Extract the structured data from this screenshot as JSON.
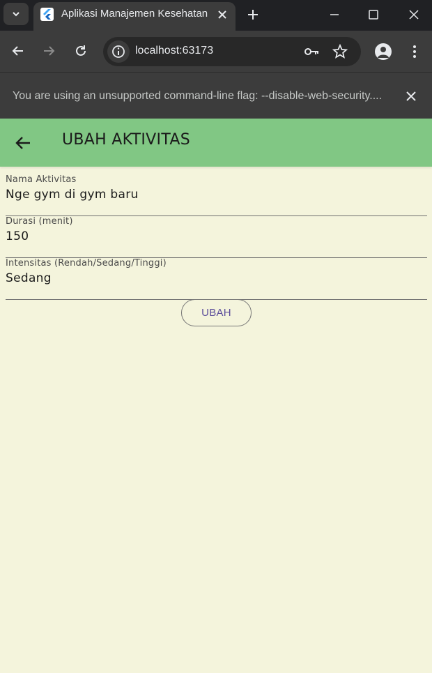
{
  "browser": {
    "tab_title": "Aplikasi Manajemen Kesehatan",
    "url": "localhost:63173",
    "infobar_message": "You are using an unsupported command-line flag: --disable-web-security...."
  },
  "appbar": {
    "title": "UBAH AKTIVITAS"
  },
  "form": {
    "fields": [
      {
        "label": "Nama Aktivitas",
        "value": "Nge gym di gym baru"
      },
      {
        "label": "Durasi (menit)",
        "value": "150"
      },
      {
        "label": "Intensitas (Rendah/Sedang/Tinggi)",
        "value": "Sedang"
      }
    ],
    "submit_label": "UBAH"
  },
  "colors": {
    "appbar_bg": "#81c784",
    "page_bg": "#f4f4dc",
    "button_text": "#5b4c9a",
    "browser_chrome": "#3c3c3c"
  },
  "icons": [
    "tab-search-icon",
    "flutter-favicon-icon",
    "close-icon",
    "plus-icon",
    "minimize-icon",
    "maximize-icon",
    "back-arrow-icon",
    "forward-arrow-icon",
    "reload-icon",
    "info-icon",
    "key-icon",
    "star-icon",
    "profile-icon",
    "kebab-menu-icon"
  ]
}
